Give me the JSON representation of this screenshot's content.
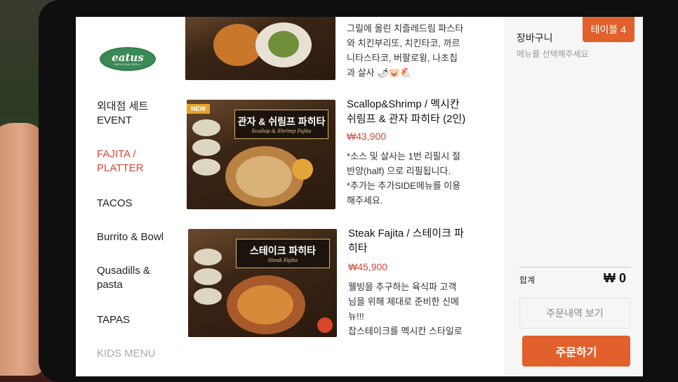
{
  "brand": {
    "logo_text": "eatus",
    "logo_sub": "MEXICAN GRILL"
  },
  "nav": {
    "items": [
      {
        "label": "외대점 세트\nEVENT"
      },
      {
        "label": "FAJITA /\nPLATTER"
      },
      {
        "label": "TACOS"
      },
      {
        "label": "Burrito & Bowl"
      },
      {
        "label": "Qusadills  &\npasta"
      },
      {
        "label": "TAPAS"
      },
      {
        "label": "KIDS MENU"
      }
    ],
    "active_index": 1
  },
  "menu": {
    "items": [
      {
        "desc": "그릴에 올린 치즐레드림 파스타\n와 치킨부리또, 치킨타코, 까르\n니타스타코, 버팔로윙, 나초칩\n과 살사 🌶🐷🐔"
      },
      {
        "badge": "NEW",
        "banner_ko": "관자 & 쉬림프 파히타",
        "banner_en": "Scallop & Shrimp Fajita",
        "name": "Scallop&Shrimp / 멕시칸\n쉬림프 & 관자 파히타 (2인)",
        "price": "₩43,900",
        "desc": "*소스 및 살사는 1번 리필시 절\n반양(half) 으로 리필됩니다.\n*추가는 추가SIDE메뉴를 이용\n해주세요."
      },
      {
        "banner_ko": "스테이크 파히타",
        "banner_en": "Steak Fajita",
        "name": "Steak Fajita / 스테이크 파\n히타",
        "price": "₩45,900",
        "desc": "웰빙을 추구하는 육식파 고객\n님을 위해 제대로 준비한 신메\n뉴!!!\n찹스테이크를 멕시칸 스타일로"
      }
    ]
  },
  "cart": {
    "title": "장바구니",
    "subtitle": "메뉴를 선택해주세요",
    "table_label": "테이블 4",
    "total_label": "합계",
    "total_value": "₩ 0",
    "history_button": "주문내역 보기",
    "order_button": "주문하기"
  },
  "colors": {
    "accent": "#e2602c",
    "active_nav": "#d2483b",
    "price": "#d2483b"
  }
}
